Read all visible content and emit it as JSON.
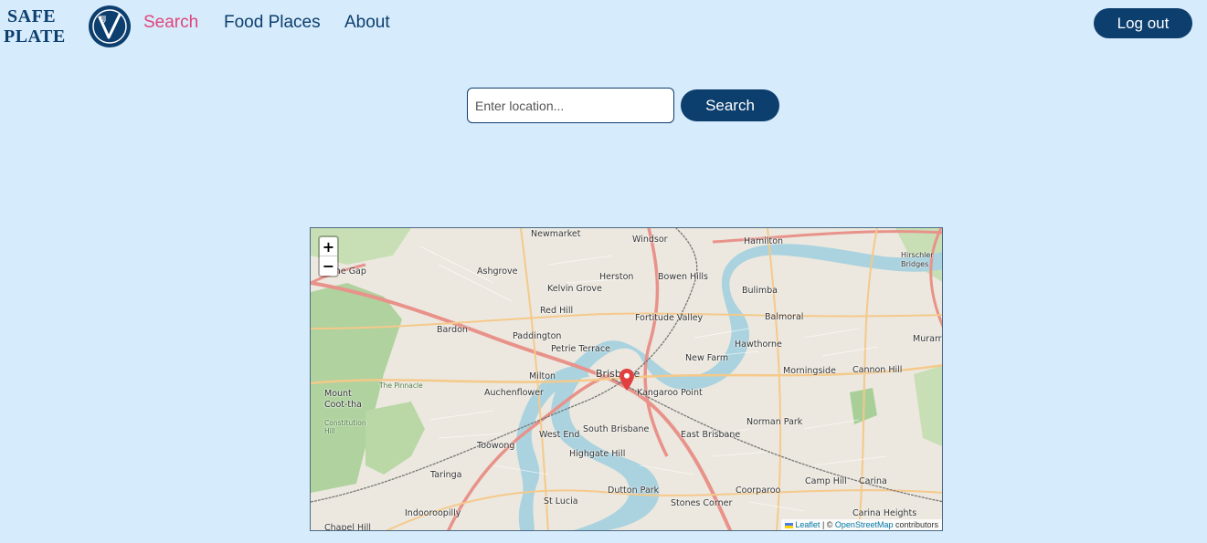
{
  "logo": {
    "line1": "SAFE",
    "line2": "PLATE"
  },
  "nav": {
    "items": [
      {
        "label": "Search",
        "active": true
      },
      {
        "label": "Food Places",
        "active": false
      },
      {
        "label": "About",
        "active": false
      }
    ],
    "logout_label": "Log out"
  },
  "search": {
    "placeholder": "Enter location...",
    "value": "",
    "button_label": "Search"
  },
  "map": {
    "zoom_in": "+",
    "zoom_out": "−",
    "attribution": {
      "leaflet": "Leaflet",
      "separator": " | © ",
      "osm": "OpenStreetMap",
      "suffix": " contributors"
    },
    "labels": {
      "newmarket": "Newmarket",
      "windsor": "Windsor",
      "hamilton": "Hamilton",
      "thegap": "The Gap",
      "ashgrove": "Ashgrove",
      "herston": "Herston",
      "bowenhills": "Bowen Hills",
      "bulimba": "Bulimba",
      "hirschlerbridges": "Hirschler Bridges",
      "kelvingrove": "Kelvin Grove",
      "redhill": "Red Hill",
      "fortitudevalley": "Fortitude Valley",
      "balmoral": "Balmoral",
      "bardon": "Bardon",
      "paddington": "Paddington",
      "petrieterrace": "Petrie Terrace",
      "newfarm": "New Farm",
      "hawthorne": "Hawthorne",
      "murarrie": "Murarrie",
      "brisbane": "Brisbane",
      "milton": "Milton",
      "morningside": "Morningside",
      "cannonhill": "Cannon Hill",
      "mountcootha": "Mount Coot-tha",
      "auchenflower": "Auchenflower",
      "kangaroopoint": "Kangaroo Point",
      "normanpark": "Norman Park",
      "westend": "West End",
      "southbrisbane": "South Brisbane",
      "eastbrisbane": "East Brisbane",
      "toowong": "Toowong",
      "highgatehill": "Highgate Hill",
      "camphill": "Camp Hill",
      "carina": "Carina",
      "taringa": "Taringa",
      "duttonpark": "Dutton Park",
      "coorparoo": "Coorparoo",
      "stlucia": "St Lucia",
      "stonescorner": "Stones Corner",
      "indooroopilly": "Indooroopilly",
      "carinaheights": "Carina Heights",
      "chapelhill": "Chapel Hill",
      "thepinnacle": "The Pinnacle",
      "constitutionhill": "Constitution Hill"
    }
  },
  "colors": {
    "brand": "#0c3e6e",
    "active": "#e0457b",
    "background": "#d6ebfb"
  }
}
